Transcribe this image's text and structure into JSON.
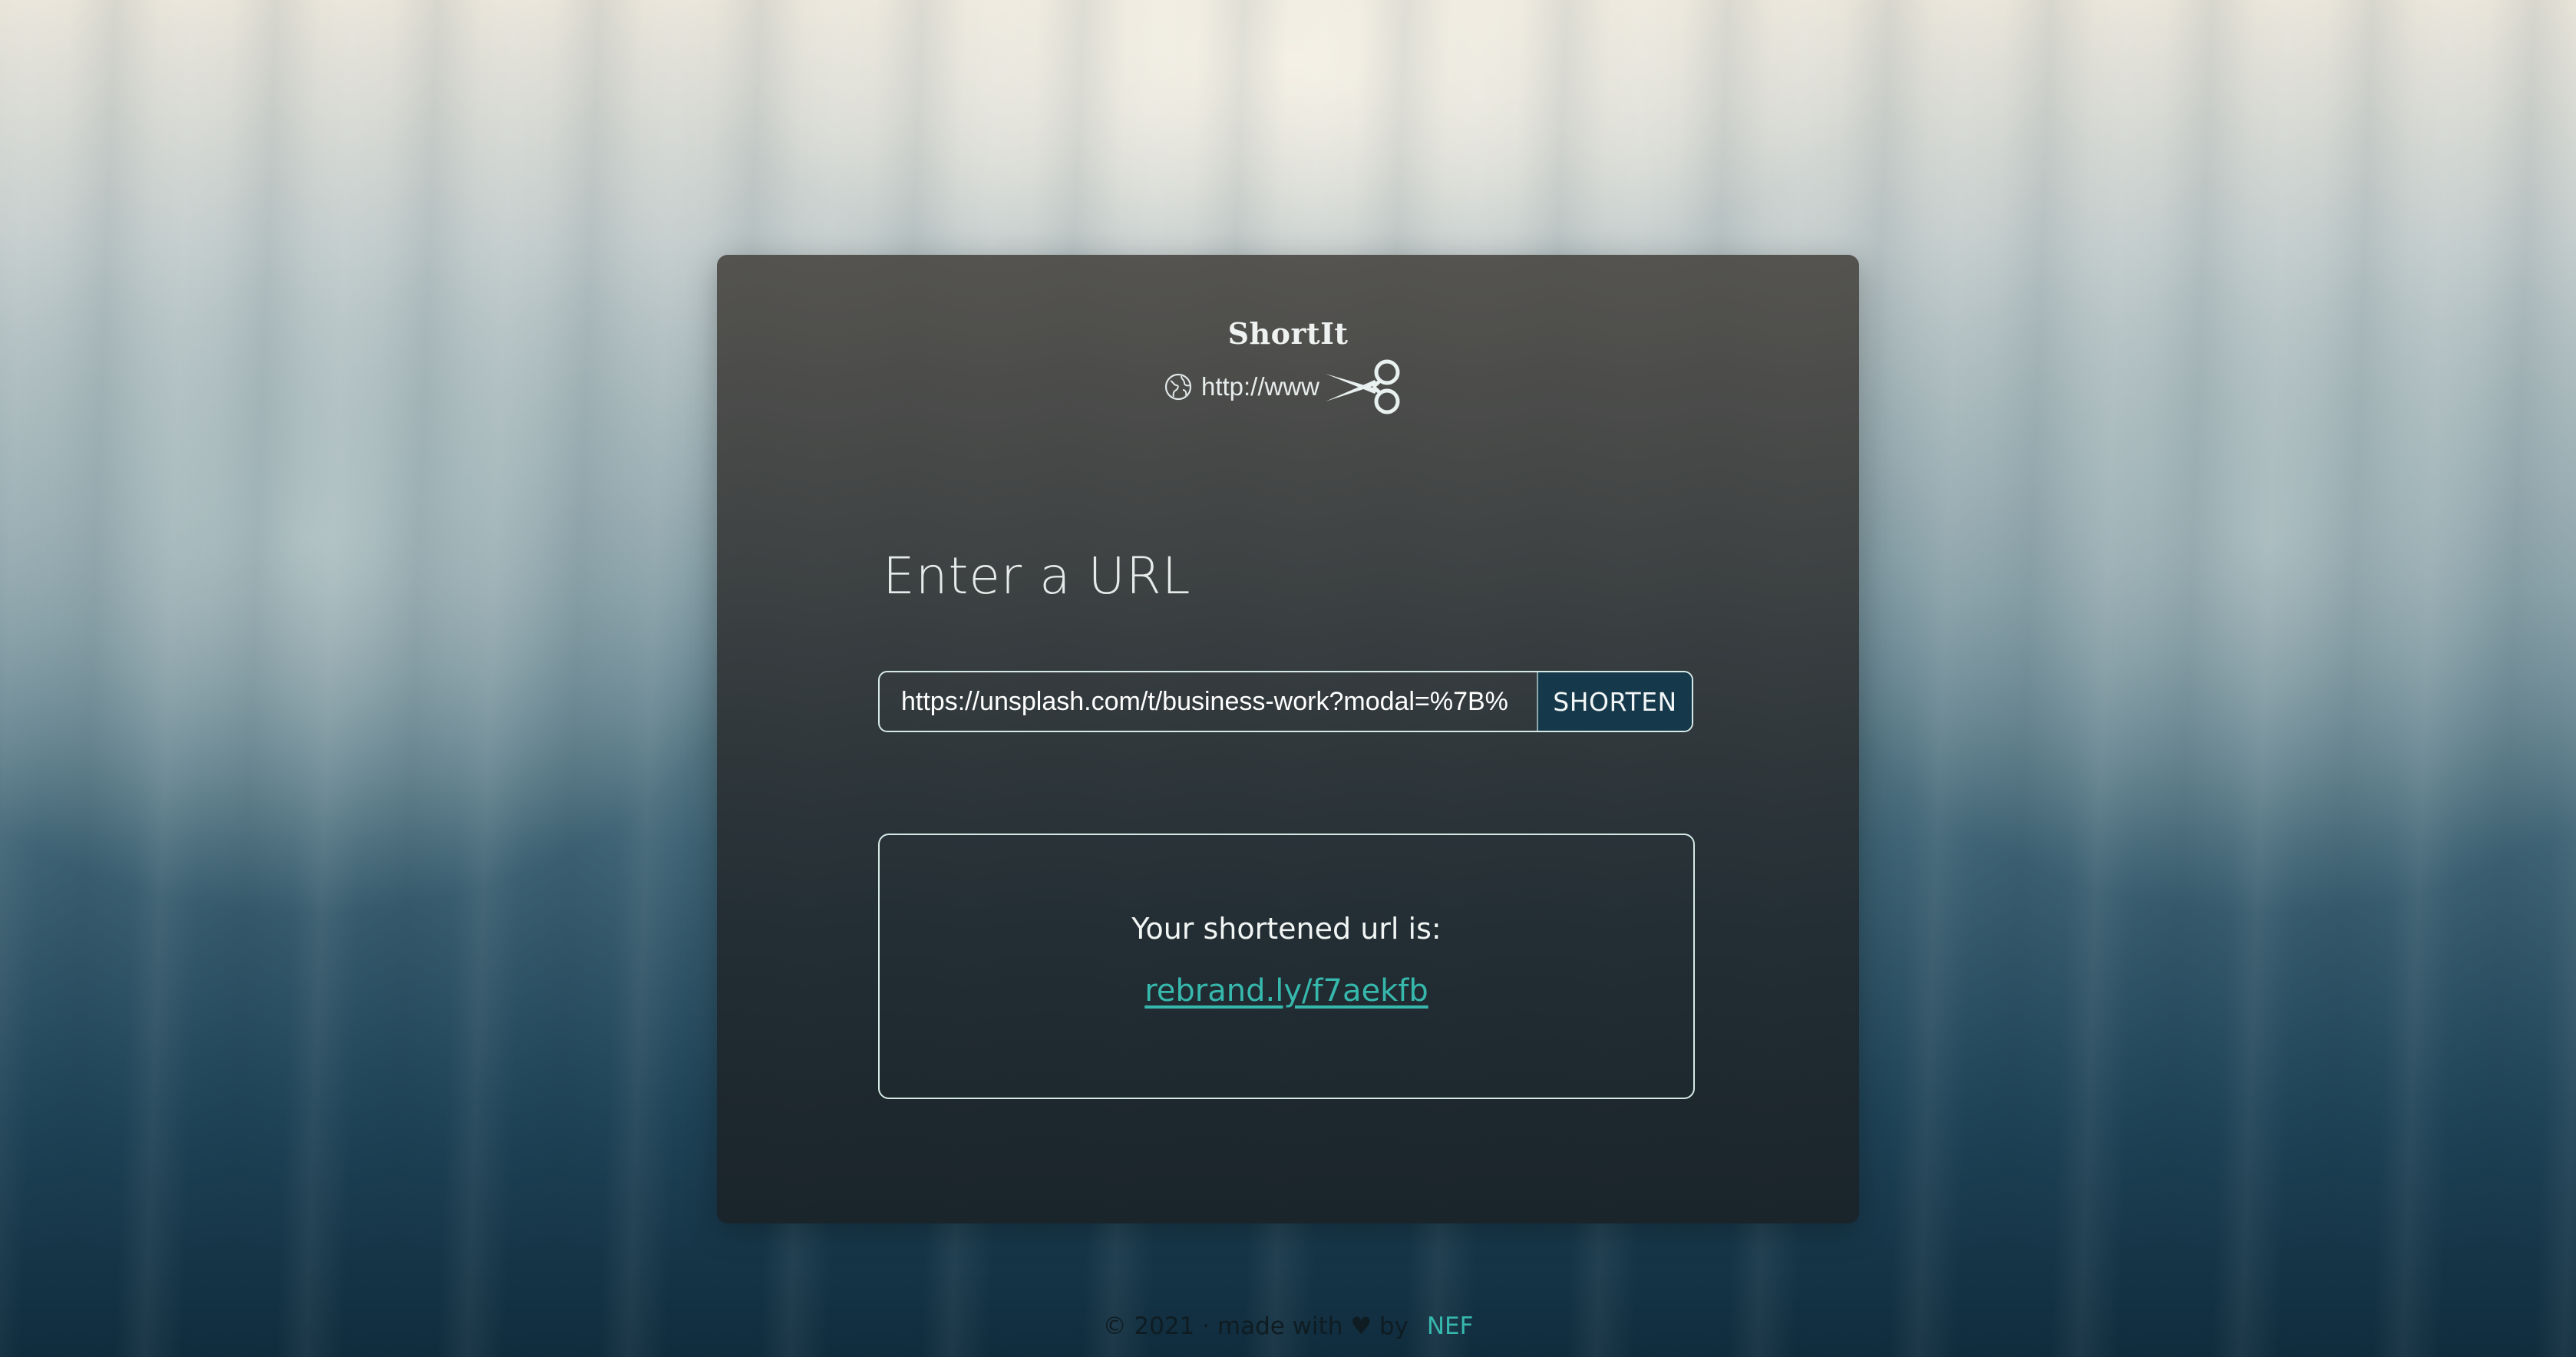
{
  "app": {
    "title": "ShortIt",
    "logo_text": "http://www"
  },
  "form": {
    "heading": "Enter a URL",
    "url_value": "https://unsplash.com/t/business-work?modal=%7B%",
    "shorten_label": "SHORTEN"
  },
  "result": {
    "label": "Your shortened url is:",
    "short_url": "rebrand.ly/f7aekfb"
  },
  "footer": {
    "text": "© 2021 · made with ♥ by",
    "author": "NEF"
  },
  "colors": {
    "accent": "#36b8ad",
    "button_bg": "#15384a",
    "border": "#d5eae6"
  },
  "icons": [
    "globe-icon",
    "scissors-icon"
  ]
}
